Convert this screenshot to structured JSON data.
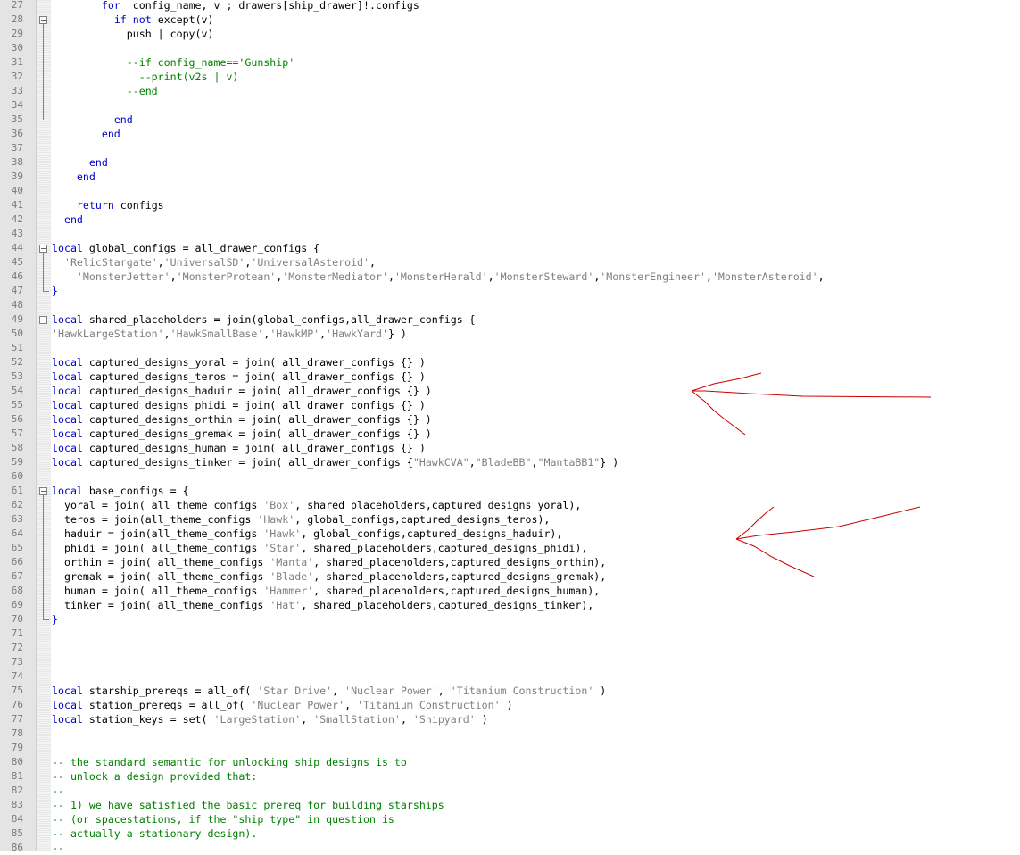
{
  "editor": {
    "lines": [
      {
        "n": "27",
        "tokens": [
          [
            "",
            "        "
          ],
          [
            "kw",
            "for"
          ],
          [
            "",
            "  config_name, v ; drawers[ship_drawer]!.configs"
          ]
        ]
      },
      {
        "n": "28",
        "fold": "start",
        "tokens": [
          [
            "",
            "          "
          ],
          [
            "kw",
            "if"
          ],
          [
            "",
            " "
          ],
          [
            "kw",
            "not"
          ],
          [
            "",
            " except(v)"
          ]
        ]
      },
      {
        "n": "29",
        "tokens": [
          [
            "",
            "            push | copy(v)"
          ]
        ]
      },
      {
        "n": "30",
        "tokens": []
      },
      {
        "n": "31",
        "tokens": [
          [
            "cm",
            "            --if config_name=='Gunship'"
          ]
        ]
      },
      {
        "n": "32",
        "tokens": [
          [
            "cm",
            "              --print(v2s | v)"
          ]
        ]
      },
      {
        "n": "33",
        "tokens": [
          [
            "cm",
            "            --end"
          ]
        ]
      },
      {
        "n": "34",
        "tokens": []
      },
      {
        "n": "35",
        "fold": "end",
        "tokens": [
          [
            "",
            "          "
          ],
          [
            "kw",
            "end"
          ]
        ]
      },
      {
        "n": "36",
        "tokens": [
          [
            "",
            "        "
          ],
          [
            "kw",
            "end"
          ]
        ]
      },
      {
        "n": "37",
        "tokens": []
      },
      {
        "n": "38",
        "tokens": [
          [
            "",
            "      "
          ],
          [
            "kw",
            "end"
          ]
        ]
      },
      {
        "n": "39",
        "tokens": [
          [
            "",
            "    "
          ],
          [
            "kw",
            "end"
          ]
        ]
      },
      {
        "n": "40",
        "tokens": []
      },
      {
        "n": "41",
        "tokens": [
          [
            "",
            "    "
          ],
          [
            "kw",
            "return"
          ],
          [
            "",
            " configs"
          ]
        ]
      },
      {
        "n": "42",
        "tokens": [
          [
            "",
            "  "
          ],
          [
            "kw",
            "end"
          ]
        ]
      },
      {
        "n": "43",
        "tokens": []
      },
      {
        "n": "44",
        "fold": "start",
        "tokens": [
          [
            "kw",
            "local"
          ],
          [
            "",
            " global_configs = all_drawer_configs {"
          ]
        ]
      },
      {
        "n": "45",
        "tokens": [
          [
            "",
            "  "
          ],
          [
            "str",
            "'RelicStargate'"
          ],
          [
            "",
            ","
          ],
          [
            "str",
            "'UniversalSD'"
          ],
          [
            "",
            ","
          ],
          [
            "str",
            "'UniversalAsteroid'"
          ],
          [
            "",
            ","
          ]
        ]
      },
      {
        "n": "46",
        "tokens": [
          [
            "",
            "    "
          ],
          [
            "str",
            "'MonsterJetter'"
          ],
          [
            "",
            ","
          ],
          [
            "str",
            "'MonsterProtean'"
          ],
          [
            "",
            ","
          ],
          [
            "str",
            "'MonsterMediator'"
          ],
          [
            "",
            ","
          ],
          [
            "str",
            "'MonsterHerald'"
          ],
          [
            "",
            ","
          ],
          [
            "str",
            "'MonsterSteward'"
          ],
          [
            "",
            ","
          ],
          [
            "str",
            "'MonsterEngineer'"
          ],
          [
            "",
            ","
          ],
          [
            "str",
            "'MonsterAsteroid'"
          ],
          [
            "",
            ","
          ]
        ]
      },
      {
        "n": "47",
        "fold": "end",
        "tokens": [
          [
            "kw",
            "}"
          ]
        ]
      },
      {
        "n": "48",
        "tokens": []
      },
      {
        "n": "49",
        "fold": "start",
        "tokens": [
          [
            "kw",
            "local"
          ],
          [
            "",
            " shared_placeholders = join(global_configs,all_drawer_configs {"
          ]
        ]
      },
      {
        "n": "50",
        "tokens": [
          [
            "str",
            "'HawkLargeStation'"
          ],
          [
            "",
            ","
          ],
          [
            "str",
            "'HawkSmallBase'"
          ],
          [
            "",
            ","
          ],
          [
            "str",
            "'HawkMP'"
          ],
          [
            "",
            ","
          ],
          [
            "str",
            "'HawkYard'"
          ],
          [
            "",
            "} )"
          ]
        ]
      },
      {
        "n": "51",
        "tokens": []
      },
      {
        "n": "52",
        "tokens": [
          [
            "kw",
            "local"
          ],
          [
            "",
            " captured_designs_yoral = join( all_drawer_configs {} )"
          ]
        ]
      },
      {
        "n": "53",
        "tokens": [
          [
            "kw",
            "local"
          ],
          [
            "",
            " captured_designs_teros = join( all_drawer_configs {} )"
          ]
        ]
      },
      {
        "n": "54",
        "tokens": [
          [
            "kw",
            "local"
          ],
          [
            "",
            " captured_designs_haduir = join( all_drawer_configs {} )"
          ]
        ]
      },
      {
        "n": "55",
        "tokens": [
          [
            "kw",
            "local"
          ],
          [
            "",
            " captured_designs_phidi = join( all_drawer_configs {} )"
          ]
        ]
      },
      {
        "n": "56",
        "tokens": [
          [
            "kw",
            "local"
          ],
          [
            "",
            " captured_designs_orthin = join( all_drawer_configs {} )"
          ]
        ]
      },
      {
        "n": "57",
        "tokens": [
          [
            "kw",
            "local"
          ],
          [
            "",
            " captured_designs_gremak = join( all_drawer_configs {} )"
          ]
        ]
      },
      {
        "n": "58",
        "tokens": [
          [
            "kw",
            "local"
          ],
          [
            "",
            " captured_designs_human = join( all_drawer_configs {} )"
          ]
        ]
      },
      {
        "n": "59",
        "tokens": [
          [
            "kw",
            "local"
          ],
          [
            "",
            " captured_designs_tinker = join( all_drawer_configs {"
          ],
          [
            "dq",
            "\"HawkCVA\""
          ],
          [
            "",
            ","
          ],
          [
            "dq",
            "\"BladeBB\""
          ],
          [
            "",
            ","
          ],
          [
            "dq",
            "\"MantaBB1\""
          ],
          [
            "",
            "} )"
          ]
        ]
      },
      {
        "n": "60",
        "tokens": []
      },
      {
        "n": "61",
        "fold": "start",
        "tokens": [
          [
            "kw",
            "local"
          ],
          [
            "",
            " base_configs = {"
          ]
        ]
      },
      {
        "n": "62",
        "tokens": [
          [
            "",
            "  yoral = join( all_theme_configs "
          ],
          [
            "str",
            "'Box'"
          ],
          [
            "",
            ", shared_placeholders,captured_designs_yoral),"
          ]
        ]
      },
      {
        "n": "63",
        "tokens": [
          [
            "",
            "  teros = join(all_theme_configs "
          ],
          [
            "str",
            "'Hawk'"
          ],
          [
            "",
            ", global_configs,captured_designs_teros),"
          ]
        ]
      },
      {
        "n": "64",
        "tokens": [
          [
            "",
            "  haduir = join(all_theme_configs "
          ],
          [
            "str",
            "'Hawk'"
          ],
          [
            "",
            ", global_configs,captured_designs_haduir),"
          ]
        ]
      },
      {
        "n": "65",
        "tokens": [
          [
            "",
            "  phidi = join( all_theme_configs "
          ],
          [
            "str",
            "'Star'"
          ],
          [
            "",
            ", shared_placeholders,captured_designs_phidi),"
          ]
        ]
      },
      {
        "n": "66",
        "tokens": [
          [
            "",
            "  orthin = join( all_theme_configs "
          ],
          [
            "str",
            "'Manta'"
          ],
          [
            "",
            ", shared_placeholders,captured_designs_orthin),"
          ]
        ]
      },
      {
        "n": "67",
        "tokens": [
          [
            "",
            "  gremak = join( all_theme_configs "
          ],
          [
            "str",
            "'Blade'"
          ],
          [
            "",
            ", shared_placeholders,captured_designs_gremak),"
          ]
        ]
      },
      {
        "n": "68",
        "tokens": [
          [
            "",
            "  human = join( all_theme_configs "
          ],
          [
            "str",
            "'Hammer'"
          ],
          [
            "",
            ", shared_placeholders,captured_designs_human),"
          ]
        ]
      },
      {
        "n": "69",
        "tokens": [
          [
            "",
            "  tinker = join( all_theme_configs "
          ],
          [
            "str",
            "'Hat'"
          ],
          [
            "",
            ", shared_placeholders,captured_designs_tinker),"
          ]
        ]
      },
      {
        "n": "70",
        "fold": "end",
        "tokens": [
          [
            "kw",
            "}"
          ]
        ]
      },
      {
        "n": "71",
        "tokens": []
      },
      {
        "n": "72",
        "tokens": []
      },
      {
        "n": "73",
        "tokens": []
      },
      {
        "n": "74",
        "tokens": []
      },
      {
        "n": "75",
        "tokens": [
          [
            "kw",
            "local"
          ],
          [
            "",
            " starship_prereqs = all_of( "
          ],
          [
            "str",
            "'Star Drive'"
          ],
          [
            "",
            ", "
          ],
          [
            "str",
            "'Nuclear Power'"
          ],
          [
            "",
            ", "
          ],
          [
            "str",
            "'Titanium Construction'"
          ],
          [
            "",
            " )"
          ]
        ]
      },
      {
        "n": "76",
        "tokens": [
          [
            "kw",
            "local"
          ],
          [
            "",
            " station_prereqs = all_of( "
          ],
          [
            "str",
            "'Nuclear Power'"
          ],
          [
            "",
            ", "
          ],
          [
            "str",
            "'Titanium Construction'"
          ],
          [
            "",
            " )"
          ]
        ]
      },
      {
        "n": "77",
        "tokens": [
          [
            "kw",
            "local"
          ],
          [
            "",
            " station_keys = set( "
          ],
          [
            "str",
            "'LargeStation'"
          ],
          [
            "",
            ", "
          ],
          [
            "str",
            "'SmallStation'"
          ],
          [
            "",
            ", "
          ],
          [
            "str",
            "'Shipyard'"
          ],
          [
            "",
            " )"
          ]
        ]
      },
      {
        "n": "78",
        "tokens": []
      },
      {
        "n": "79",
        "tokens": []
      },
      {
        "n": "80",
        "tokens": [
          [
            "cm",
            "-- the standard semantic for unlocking ship designs is to"
          ]
        ]
      },
      {
        "n": "81",
        "tokens": [
          [
            "cm",
            "-- unlock a design provided that:"
          ]
        ]
      },
      {
        "n": "82",
        "tokens": [
          [
            "cm",
            "--"
          ]
        ]
      },
      {
        "n": "83",
        "tokens": [
          [
            "cm",
            "-- 1) we have satisfied the basic prereq for building starships"
          ]
        ]
      },
      {
        "n": "84",
        "tokens": [
          [
            "cm",
            "-- (or spacestations, if the \"ship type\" in question is"
          ]
        ]
      },
      {
        "n": "85",
        "tokens": [
          [
            "cm",
            "-- actually a stationary design)."
          ]
        ]
      },
      {
        "n": "86",
        "tokens": [
          [
            "cm",
            "--"
          ]
        ]
      }
    ]
  },
  "colors": {
    "keyword": "#0000cc",
    "string": "#808080",
    "comment": "#008000",
    "annotation": "#cc0000"
  },
  "annotations": [
    "red-arrow",
    "red-arrow"
  ]
}
